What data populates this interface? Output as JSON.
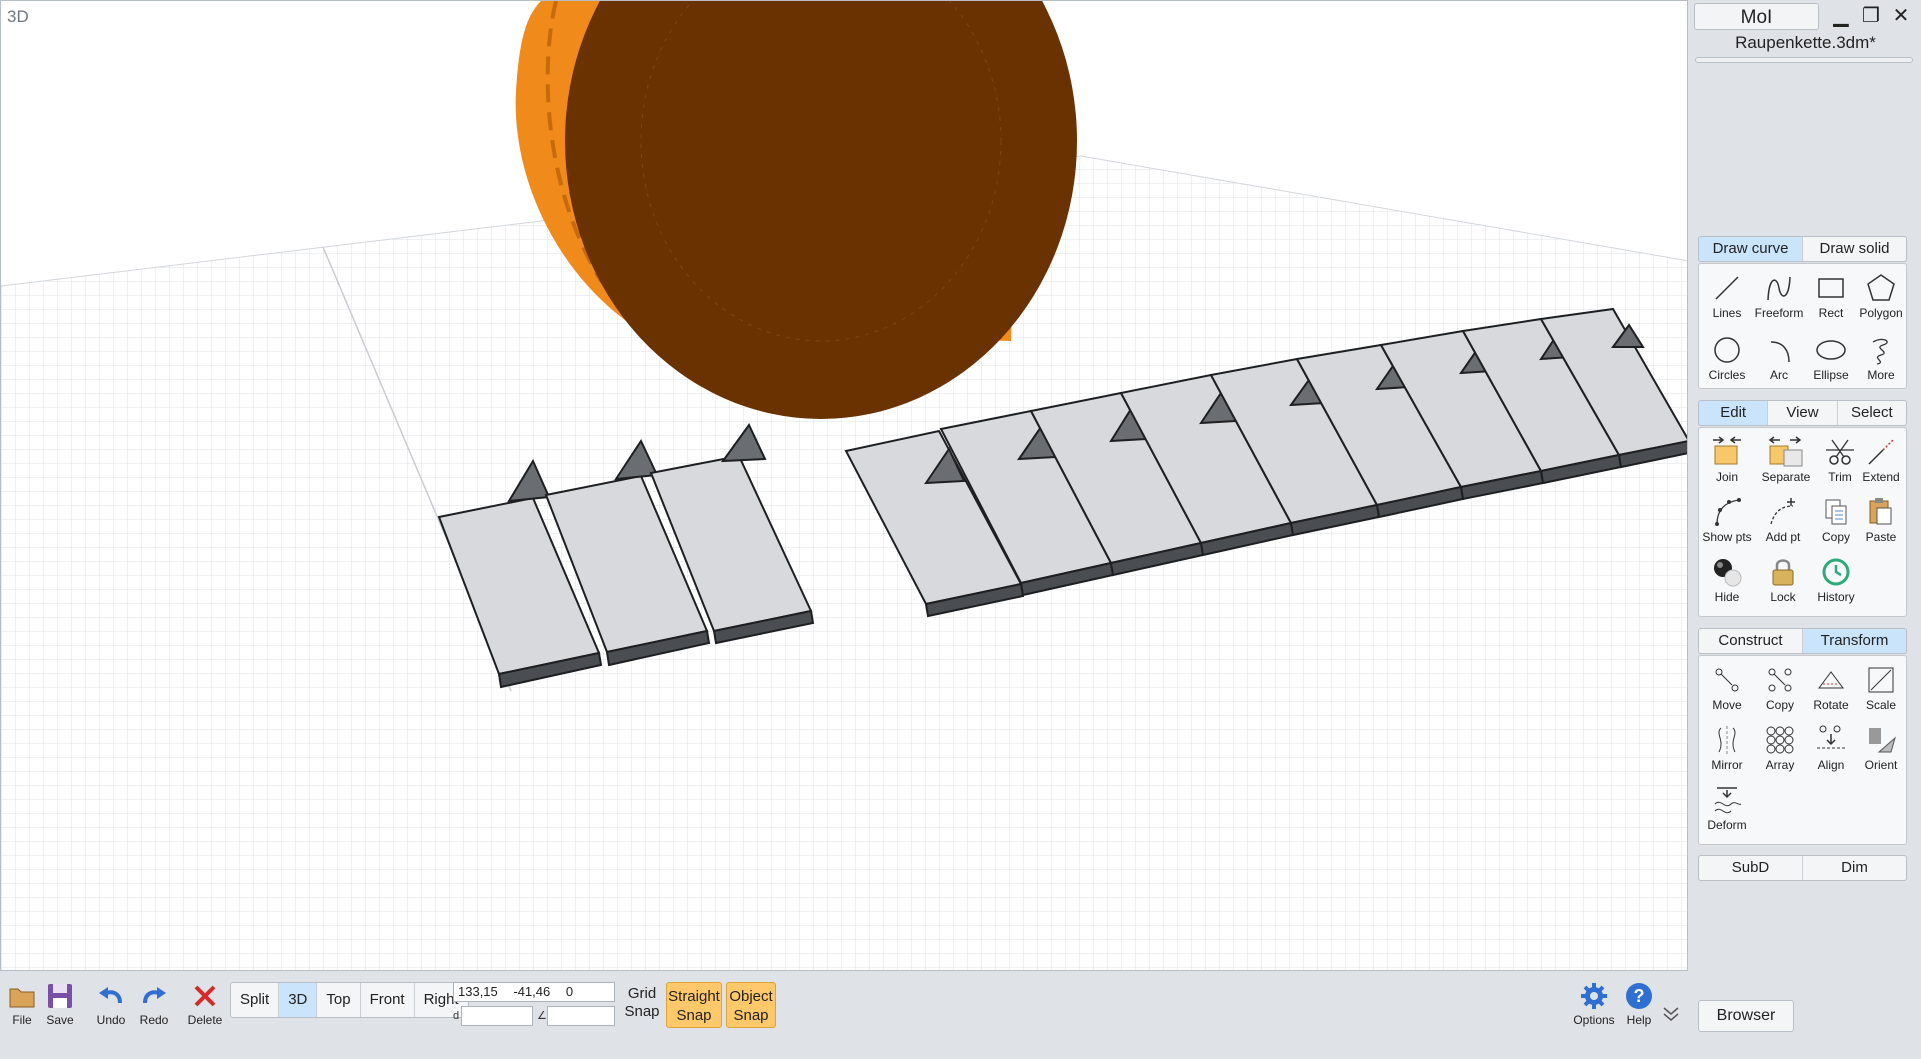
{
  "viewport": {
    "label": "3D"
  },
  "app": {
    "name": "MoI",
    "filename": "Raupenkette.3dm*",
    "window_controls": {
      "minimize": "▁",
      "restore": "❐",
      "close": "✕"
    }
  },
  "draw_tabs": {
    "left": "Draw curve",
    "right": "Draw solid"
  },
  "draw_tools": [
    {
      "label": "Lines",
      "icon": "line-icon"
    },
    {
      "label": "Freeform",
      "icon": "freeform-icon"
    },
    {
      "label": "Rect",
      "icon": "rect-icon"
    },
    {
      "label": "Polygon",
      "icon": "polygon-icon"
    },
    {
      "label": "Circles",
      "icon": "circle-icon"
    },
    {
      "label": "Arc",
      "icon": "arc-icon"
    },
    {
      "label": "Ellipse",
      "icon": "ellipse-icon"
    },
    {
      "label": "More",
      "icon": "spiral-icon"
    }
  ],
  "edit_tabs": {
    "a": "Edit",
    "b": "View",
    "c": "Select"
  },
  "edit_tools": [
    {
      "label": "Join",
      "icon": "join-icon"
    },
    {
      "label": "Separate",
      "icon": "separate-icon"
    },
    {
      "label": "Trim",
      "icon": "scissors-icon"
    },
    {
      "label": "Extend",
      "icon": "extend-icon"
    },
    {
      "label": "Show pts",
      "icon": "show-points-icon"
    },
    {
      "label": "Add pt",
      "icon": "add-point-icon"
    },
    {
      "label": "Copy",
      "icon": "copy-icon"
    },
    {
      "label": "Paste",
      "icon": "paste-icon"
    },
    {
      "label": "Hide",
      "icon": "hide-icon"
    },
    {
      "label": "Lock",
      "icon": "lock-icon"
    },
    {
      "label": "History",
      "icon": "history-icon"
    }
  ],
  "transform_tabs": {
    "left": "Construct",
    "right": "Transform"
  },
  "transform_tools": [
    {
      "label": "Move",
      "icon": "move-icon"
    },
    {
      "label": "Copy",
      "icon": "copy-transform-icon"
    },
    {
      "label": "Rotate",
      "icon": "rotate-icon"
    },
    {
      "label": "Scale",
      "icon": "scale-icon"
    },
    {
      "label": "Mirror",
      "icon": "mirror-icon"
    },
    {
      "label": "Array",
      "icon": "array-icon"
    },
    {
      "label": "Align",
      "icon": "align-icon"
    },
    {
      "label": "Orient",
      "icon": "orient-icon"
    },
    {
      "label": "Deform",
      "icon": "deform-icon"
    }
  ],
  "bottom_tabs": {
    "left": "SubD",
    "right": "Dim"
  },
  "bottombar": {
    "file": "File",
    "save": "Save",
    "undo": "Undo",
    "redo": "Redo",
    "delete": "Delete",
    "views": [
      "Split",
      "3D",
      "Top",
      "Front",
      "Right"
    ],
    "coords": "133,15 -41,46 0",
    "distance_label": "d",
    "grid_snap_1": "Grid",
    "grid_snap_2": "Snap",
    "straight_snap_1": "Straight",
    "straight_snap_2": "Snap",
    "object_snap_1": "Object",
    "object_snap_2": "Snap",
    "options": "Options",
    "help": "Help",
    "browser": "Browser"
  },
  "colors": {
    "accent_tab": "#c9e4fb",
    "snap_active": "#ffc96b",
    "object_orange": "#f08a1a",
    "object_dark": "#6a3200"
  }
}
